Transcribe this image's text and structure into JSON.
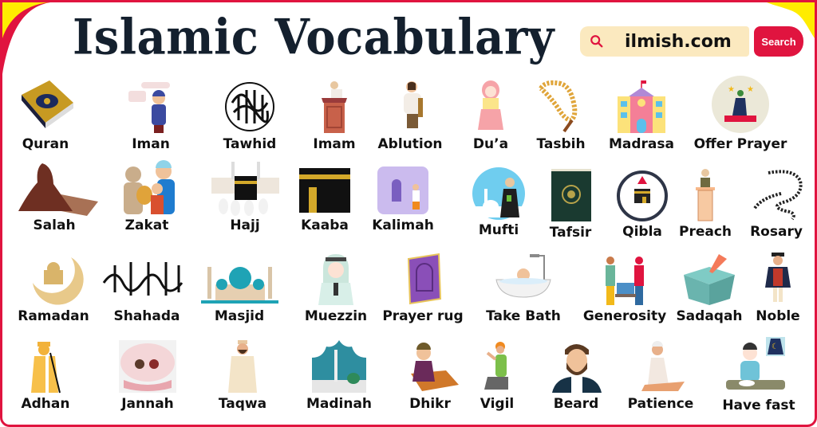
{
  "header": {
    "title": "Islamic Vocabulary",
    "search": {
      "value": "ilmish.com",
      "button_label": "Search",
      "icon": "search-icon"
    }
  },
  "colors": {
    "frame": "#e0143f",
    "corner_accent": "#ffec00",
    "title": "#14202e",
    "search_bg": "#fbe9bf",
    "button": "#e0143f"
  },
  "rows": [
    {
      "items": [
        {
          "label": "Quran",
          "icon": "quran-book-icon"
        },
        {
          "label": "Iman",
          "icon": "boy-faith-icon"
        },
        {
          "label": "Tawhid",
          "icon": "calligraphy-circle-icon"
        },
        {
          "label": "Imam",
          "icon": "imam-pulpit-icon"
        },
        {
          "label": "Ablution",
          "icon": "ablution-person-icon"
        },
        {
          "label": "Du’a",
          "icon": "girl-praying-icon"
        },
        {
          "label": "Tasbih",
          "icon": "prayer-beads-icon"
        },
        {
          "label": "Madrasa",
          "icon": "school-building-icon"
        },
        {
          "label": "Offer Prayer",
          "icon": "man-praying-on-rug-icon"
        }
      ]
    },
    {
      "items": [
        {
          "label": "Salah",
          "icon": "woman-prostrating-icon"
        },
        {
          "label": "Zakat",
          "icon": "giving-bag-icon"
        },
        {
          "label": "Hajj",
          "icon": "pilgrims-kaaba-icon"
        },
        {
          "label": "Kaaba",
          "icon": "kaaba-icon"
        },
        {
          "label": "Kalimah",
          "icon": "mosque-interior-icon"
        },
        {
          "label": "Mufti",
          "icon": "scholar-circle-icon"
        },
        {
          "label": "Tafsir",
          "icon": "green-book-icon"
        },
        {
          "label": "Qibla",
          "icon": "compass-kaaba-icon"
        },
        {
          "label": "Preach",
          "icon": "speaker-podium-icon"
        },
        {
          "label": "Rosary",
          "icon": "black-beads-icon"
        }
      ]
    },
    {
      "items": [
        {
          "label": "Ramadan",
          "icon": "crescent-mosque-icon"
        },
        {
          "label": "Shahada",
          "icon": "shahada-calligraphy-icon"
        },
        {
          "label": "Masjid",
          "icon": "mosque-domes-icon"
        },
        {
          "label": "Muezzin",
          "icon": "muezzin-person-icon"
        },
        {
          "label": "Prayer rug",
          "icon": "prayer-rug-icon"
        },
        {
          "label": "Take Bath",
          "icon": "bathtub-icon"
        },
        {
          "label": "Generosity",
          "icon": "food-sharing-icon"
        },
        {
          "label": "Sadaqah",
          "icon": "donation-box-icon"
        },
        {
          "label": "Noble",
          "icon": "nobleman-icon"
        }
      ]
    },
    {
      "items": [
        {
          "label": "Adhan",
          "icon": "caller-microphone-icon"
        },
        {
          "label": "Jannah",
          "icon": "family-garden-icon"
        },
        {
          "label": "Taqwa",
          "icon": "man-dua-icon"
        },
        {
          "label": "Madinah",
          "icon": "madinah-mosque-icon"
        },
        {
          "label": "Dhikr",
          "icon": "boy-on-rug-icon"
        },
        {
          "label": "Vigil",
          "icon": "kneeling-man-icon"
        },
        {
          "label": "Beard",
          "icon": "bearded-man-icon"
        },
        {
          "label": "Patience",
          "icon": "sitting-prayer-icon"
        },
        {
          "label": "Have fast",
          "icon": "iftar-meal-icon"
        }
      ]
    }
  ]
}
